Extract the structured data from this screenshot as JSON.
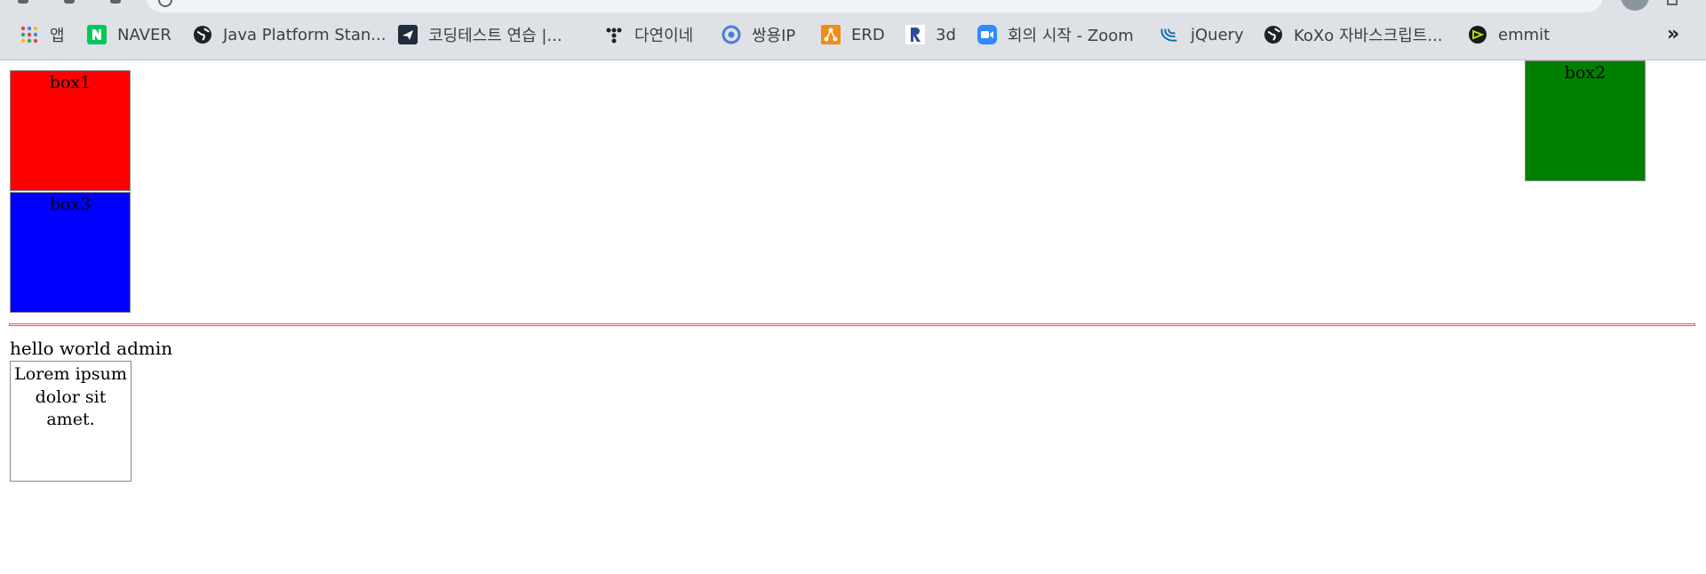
{
  "bookmarks": {
    "items": [
      {
        "label": "앱",
        "icon": "apps-grid-icon"
      },
      {
        "label": "NAVER",
        "icon": "naver-icon",
        "color": "#03c75a"
      },
      {
        "label": "Java Platform Stan...",
        "icon": "globe-icon"
      },
      {
        "label": "코딩테스트 연습 |...",
        "icon": "programmers-icon"
      },
      {
        "label": "다연이네",
        "icon": "dots-icon"
      },
      {
        "label": "쌍용IP",
        "icon": "circle-logo-icon",
        "color": "#4a7fd8"
      },
      {
        "label": "ERD",
        "icon": "erd-icon",
        "color": "#f08c1a"
      },
      {
        "label": "3d",
        "icon": "r-logo-icon"
      },
      {
        "label": "회의 시작 - Zoom",
        "icon": "zoom-icon",
        "color": "#2d8cff"
      },
      {
        "label": "jQuery",
        "icon": "jquery-icon",
        "color": "#0769ad"
      },
      {
        "label": "KoXo 자바스크립트...",
        "icon": "globe-icon"
      },
      {
        "label": "emmit",
        "icon": "emmet-icon"
      }
    ],
    "more": "»"
  },
  "page": {
    "box1": "box1",
    "box2": "box2",
    "box3": "box3",
    "hello": "hello world admin",
    "lorem": "Lorem ipsum dolor sit amet."
  },
  "colors": {
    "box1": "#ff0000",
    "box2": "#008000",
    "box3": "#0000ff",
    "hr": "#ff4d4d",
    "chrome": "#dee1e6"
  }
}
